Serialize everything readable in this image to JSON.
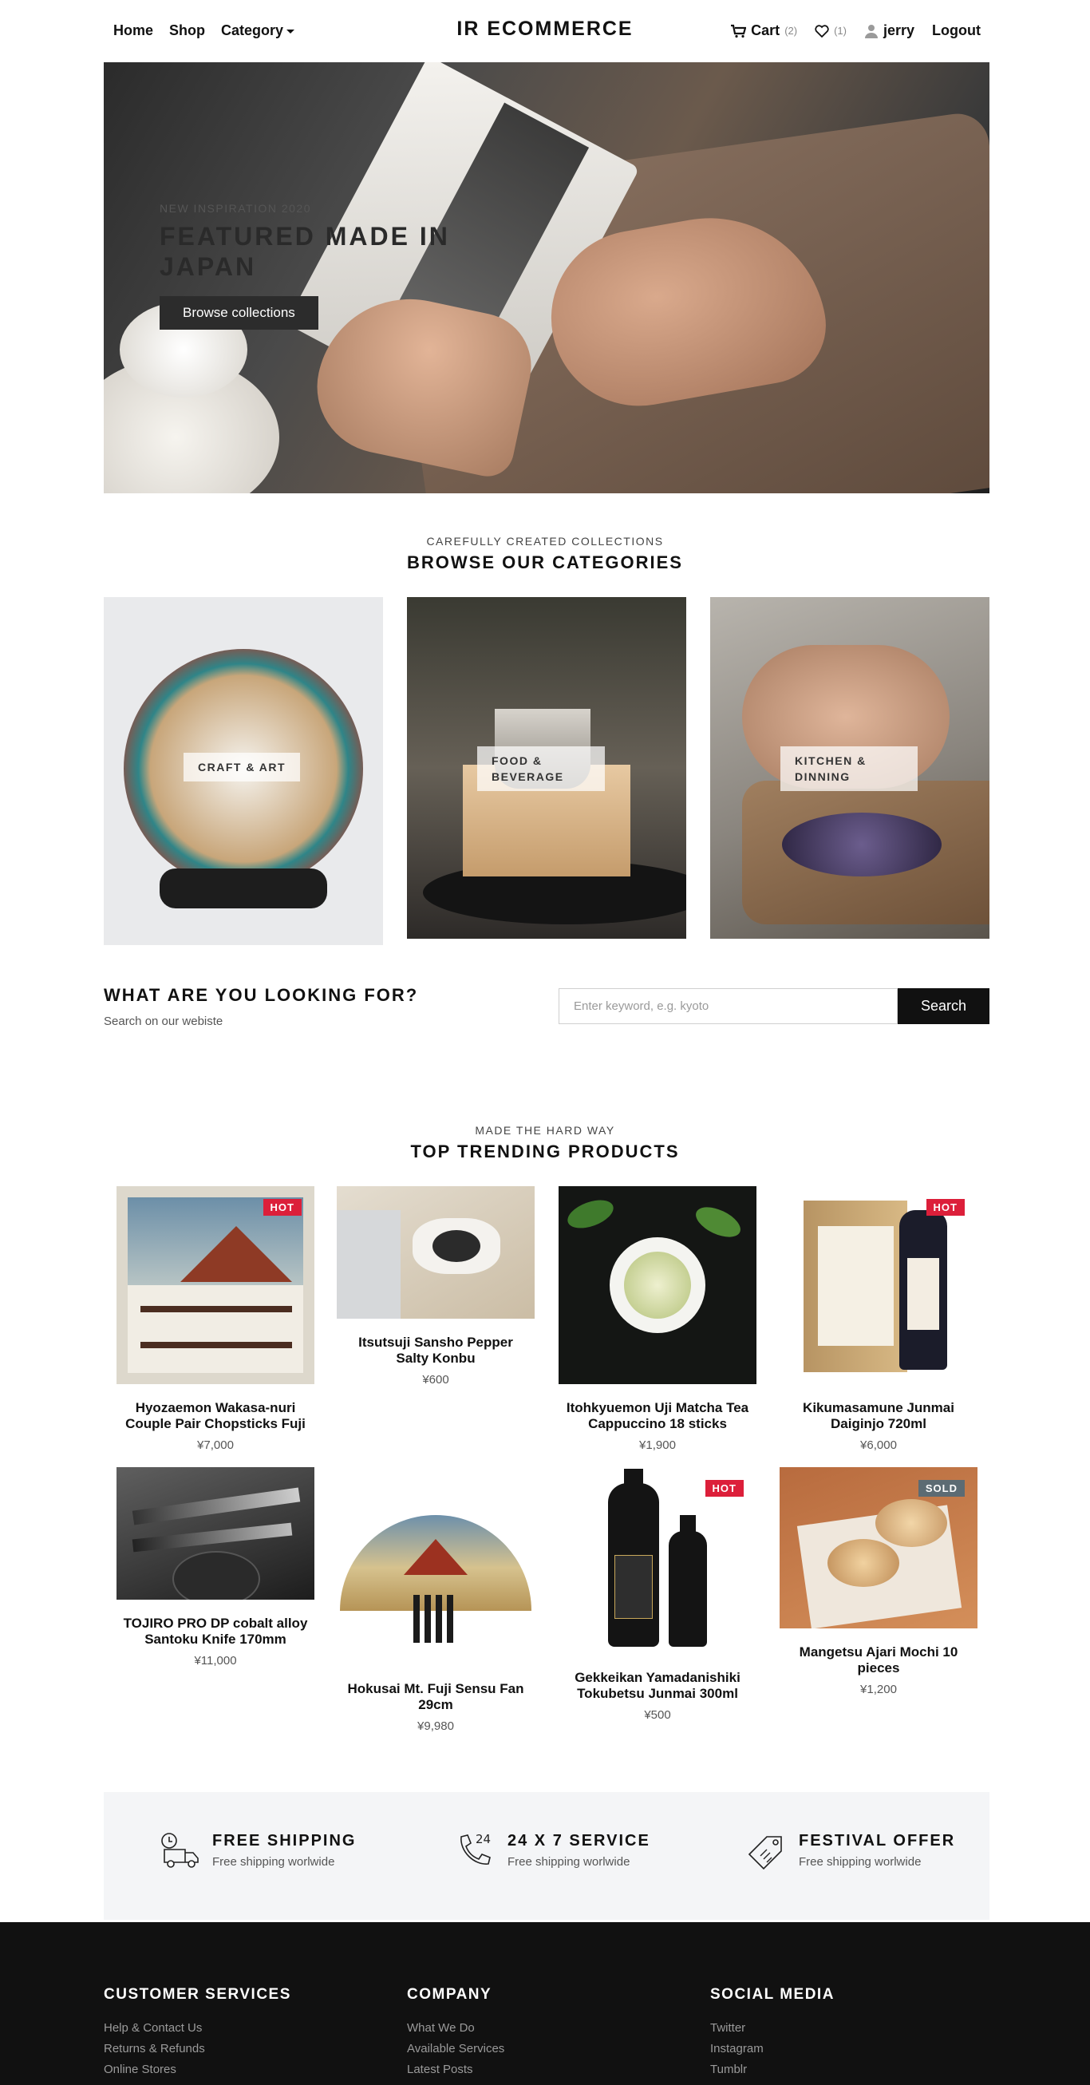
{
  "nav": {
    "home": "Home",
    "shop": "Shop",
    "category": "Category",
    "brand": "IR ECOMMERCE",
    "cart_label": "Cart",
    "cart_count": "(2)",
    "wishlist_count": "(1)",
    "user": "jerry",
    "logout": "Logout"
  },
  "hero": {
    "kicker": "NEW INSPIRATION 2020",
    "title": "FEATURED MADE IN JAPAN",
    "button": "Browse collections"
  },
  "categories": {
    "kicker": "CAREFULLY CREATED COLLECTIONS",
    "title": "BROWSE OUR CATEGORIES",
    "items": [
      {
        "label": "CRAFT & ART"
      },
      {
        "label": "FOOD & BEVERAGE"
      },
      {
        "label": "KITCHEN & DINNING"
      }
    ]
  },
  "search": {
    "title": "WHAT ARE YOU LOOKING FOR?",
    "subtitle": "Search on our webiste",
    "placeholder": "Enter keyword, e.g. kyoto",
    "button": "Search"
  },
  "products": {
    "kicker": "MADE THE HARD WAY",
    "title": "TOP TRENDING PRODUCTS",
    "items": [
      {
        "name": "Hyozaemon Wakasa-nuri Couple Pair Chopsticks Fuji",
        "price": "¥7,000",
        "tag": "HOT"
      },
      {
        "name": "Itsutsuji Sansho Pepper Salty Konbu",
        "price": "¥600",
        "tag": ""
      },
      {
        "name": "Itohkyuemon Uji Matcha Tea Cappuccino 18 sticks",
        "price": "¥1,900",
        "tag": ""
      },
      {
        "name": "Kikumasamune Junmai Daiginjo 720ml",
        "price": "¥6,000",
        "tag": "HOT"
      },
      {
        "name": "TOJIRO PRO DP cobalt alloy Santoku Knife 170mm",
        "price": "¥11,000",
        "tag": ""
      },
      {
        "name": "Hokusai Mt. Fuji Sensu Fan 29cm",
        "price": "¥9,980",
        "tag": ""
      },
      {
        "name": "Gekkeikan Yamadanishiki Tokubetsu Junmai 300ml",
        "price": "¥500",
        "tag": "HOT"
      },
      {
        "name": "Mangetsu Ajari Mochi 10 pieces",
        "price": "¥1,200",
        "tag": "SOLD"
      }
    ]
  },
  "features": [
    {
      "title": "FREE SHIPPING",
      "subtitle": "Free shipping worlwide",
      "icon": "truck-clock-icon"
    },
    {
      "title": "24 X 7 SERVICE",
      "subtitle": "Free shipping worlwide",
      "icon": "phone-24-icon",
      "icon_text": "24"
    },
    {
      "title": "FESTIVAL OFFER",
      "subtitle": "Free shipping worlwide",
      "icon": "price-tag-icon"
    }
  ],
  "footer": {
    "columns": [
      {
        "title": "CUSTOMER SERVICES",
        "links": [
          "Help & Contact Us",
          "Returns & Refunds",
          "Online Stores"
        ]
      },
      {
        "title": "COMPANY",
        "links": [
          "What We Do",
          "Available Services",
          "Latest Posts"
        ]
      },
      {
        "title": "SOCIAL MEDIA",
        "links": [
          "Twitter",
          "Instagram",
          "Tumblr"
        ]
      }
    ]
  },
  "colors": {
    "accent_hot": "#dc1f3a",
    "accent_sold": "#5c6b73",
    "footer_bg": "#111111",
    "feature_bg": "#f4f5f7"
  }
}
